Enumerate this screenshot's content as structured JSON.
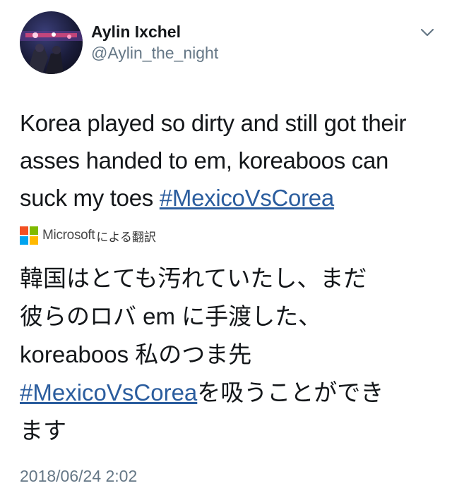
{
  "user": {
    "display_name": "Aylin Ixchel",
    "handle": "@Aylin_the_night",
    "avatar_icon": "avatar-image"
  },
  "menu_icon": "chevron-down-icon",
  "tweet": {
    "lines": [
      "Korea played so dirty and still got their",
      "asses handed to em, koreaboos can",
      "suck my toes "
    ],
    "hashtag": "#MexicoVsCorea"
  },
  "translation": {
    "provider": "Microsoft",
    "suffix": "による翻訳",
    "logo_colors": [
      "#f25022",
      "#7fba00",
      "#00a4ef",
      "#ffb900"
    ],
    "lines": [
      "韓国はとても汚れていたし、まだ",
      "彼らのロバ em に手渡した、",
      "koreaboos 私のつま先"
    ],
    "hashtag": "#MexicoVsCorea",
    "after_hashtag": "を吸うことができ",
    "last_line": "ます"
  },
  "timestamp": "2018/06/24 2:02",
  "colors": {
    "link": "#2b5d9e",
    "secondary_text": "#657786",
    "primary_text": "#14171a"
  }
}
